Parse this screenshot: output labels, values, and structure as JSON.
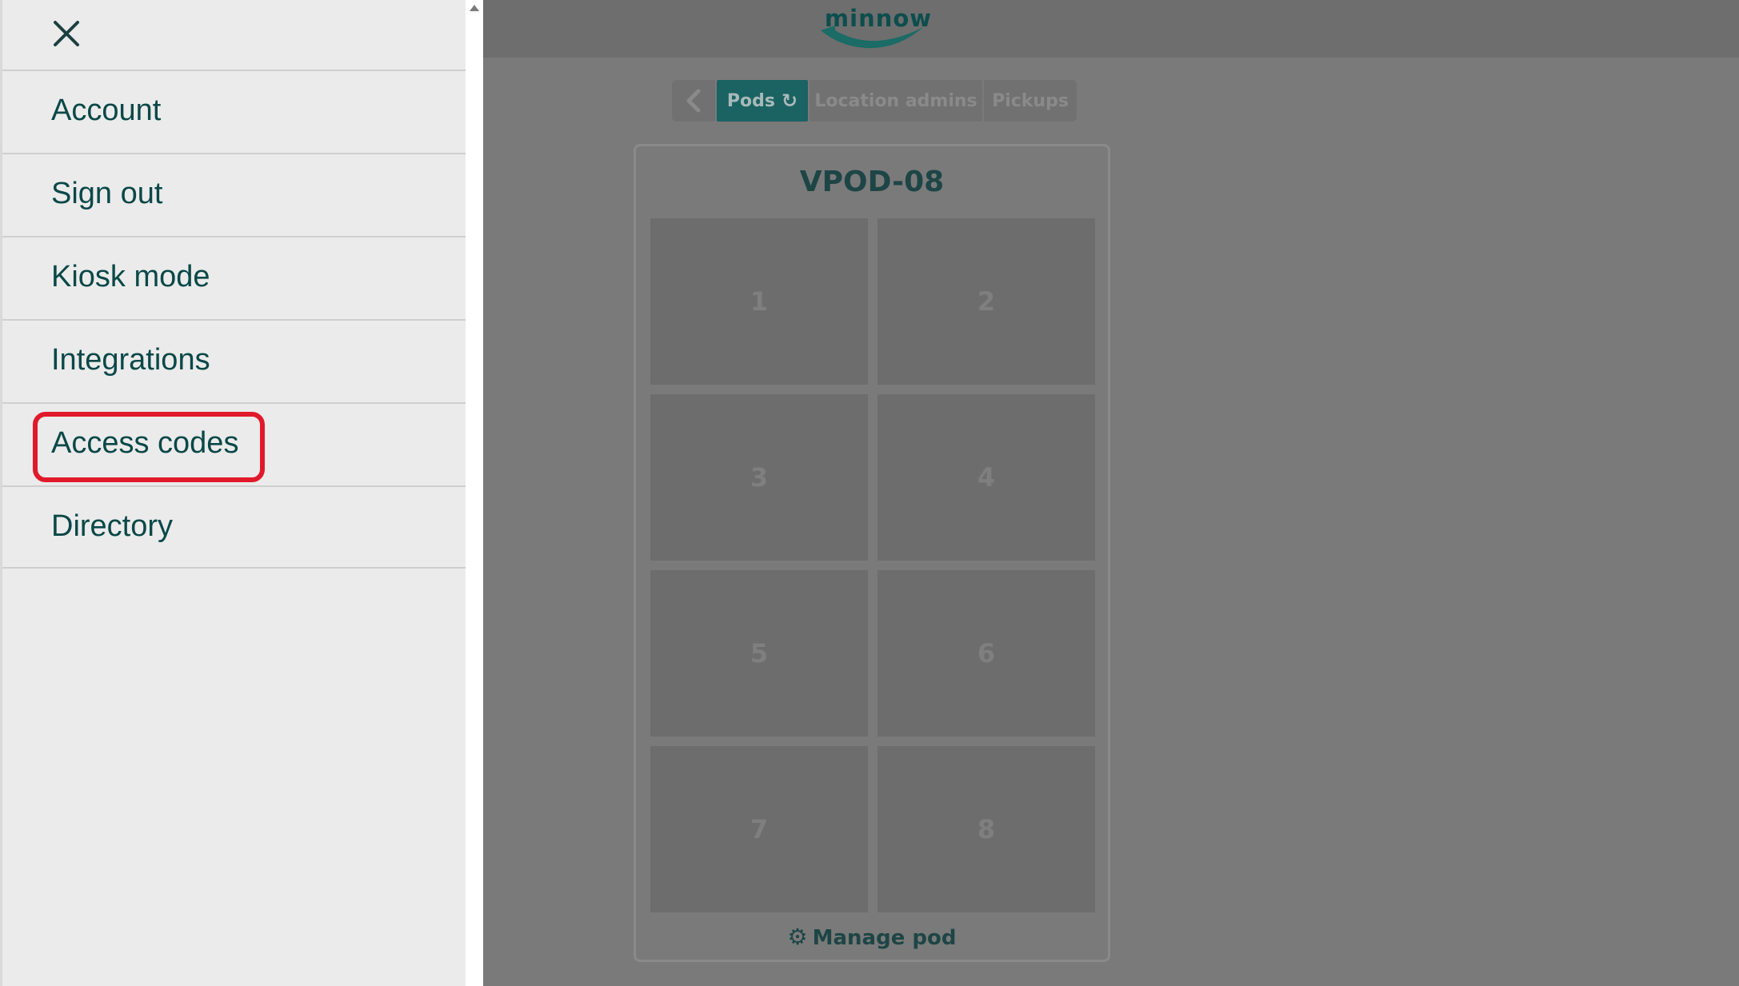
{
  "drawer": {
    "close_icon": "close-icon",
    "items": [
      {
        "label": "Account"
      },
      {
        "label": "Sign out"
      },
      {
        "label": "Kiosk mode"
      },
      {
        "label": "Integrations"
      },
      {
        "label": "Access codes"
      },
      {
        "label": "Directory"
      }
    ],
    "highlighted_item": "Access codes",
    "highlight_color": "#e0192b"
  },
  "header": {
    "logo_text": "minnow",
    "brand_color": "#1b6262"
  },
  "tabs": {
    "back_icon": "chevron-left-icon",
    "pods": "Pods",
    "pods_icon": "refresh-icon",
    "location_admins": "Location admins",
    "pickups": "Pickups"
  },
  "pod": {
    "title": "VPOD-08",
    "slots": [
      "1",
      "2",
      "3",
      "4",
      "5",
      "6",
      "7",
      "8"
    ],
    "manage_label": "Manage pod",
    "manage_icon": "gear-icon"
  }
}
